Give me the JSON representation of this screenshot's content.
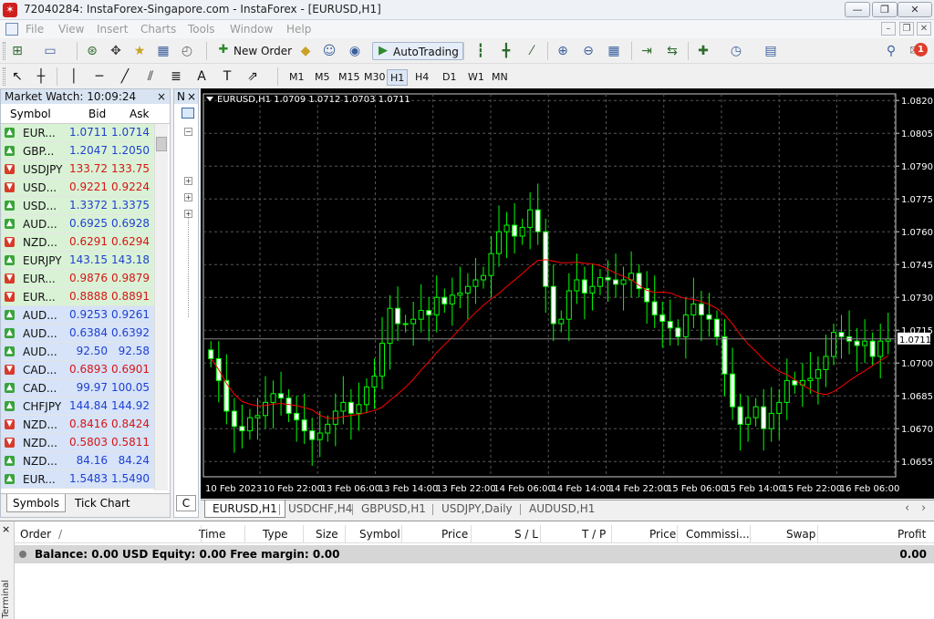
{
  "window": {
    "title": "72040284: InstaForex-Singapore.com - InstaForex - [EURUSD,H1]",
    "minimize": "—",
    "maximize": "❐",
    "close": "✕"
  },
  "menu": {
    "items": [
      "File",
      "View",
      "Insert",
      "Charts",
      "Tools",
      "Window",
      "Help"
    ],
    "mdi_minimize": "–",
    "mdi_restore": "❐",
    "mdi_close": "✕"
  },
  "toolbar": {
    "new_order_label": "New Order",
    "autotrading_label": "AutoTrading",
    "notification_count": "1"
  },
  "timeframes": {
    "items": [
      "M1",
      "M5",
      "M15",
      "M30",
      "H1",
      "H4",
      "D1",
      "W1",
      "MN"
    ],
    "active": "H1"
  },
  "market_watch": {
    "title": "Market Watch: 10:09:24",
    "close": "×",
    "columns": {
      "symbol": "Symbol",
      "bid": "Bid",
      "ask": "Ask"
    },
    "rows": [
      {
        "symbol": "EUR...",
        "bid": "1.0711",
        "ask": "1.0714",
        "dir": "up",
        "hl": "green"
      },
      {
        "symbol": "GBP...",
        "bid": "1.2047",
        "ask": "1.2050",
        "dir": "up",
        "hl": "green"
      },
      {
        "symbol": "USDJPY",
        "bid": "133.72",
        "ask": "133.75",
        "dir": "down",
        "hl": "green"
      },
      {
        "symbol": "USD...",
        "bid": "0.9221",
        "ask": "0.9224",
        "dir": "down",
        "hl": "green"
      },
      {
        "symbol": "USD...",
        "bid": "1.3372",
        "ask": "1.3375",
        "dir": "up",
        "hl": "green"
      },
      {
        "symbol": "AUD...",
        "bid": "0.6925",
        "ask": "0.6928",
        "dir": "up",
        "hl": "green"
      },
      {
        "symbol": "NZD...",
        "bid": "0.6291",
        "ask": "0.6294",
        "dir": "down",
        "hl": "green"
      },
      {
        "symbol": "EURJPY",
        "bid": "143.15",
        "ask": "143.18",
        "dir": "up",
        "hl": "green"
      },
      {
        "symbol": "EUR...",
        "bid": "0.9876",
        "ask": "0.9879",
        "dir": "down",
        "hl": "green"
      },
      {
        "symbol": "EUR...",
        "bid": "0.8888",
        "ask": "0.8891",
        "dir": "down",
        "hl": "green"
      },
      {
        "symbol": "AUD...",
        "bid": "0.9253",
        "ask": "0.9261",
        "dir": "up",
        "hl": "blue"
      },
      {
        "symbol": "AUD...",
        "bid": "0.6384",
        "ask": "0.6392",
        "dir": "up",
        "hl": "blue"
      },
      {
        "symbol": "AUD...",
        "bid": "92.50",
        "ask": "92.58",
        "dir": "up",
        "hl": "blue"
      },
      {
        "symbol": "CAD...",
        "bid": "0.6893",
        "ask": "0.6901",
        "dir": "down",
        "hl": "blue"
      },
      {
        "symbol": "CAD...",
        "bid": "99.97",
        "ask": "100.05",
        "dir": "up",
        "hl": "blue"
      },
      {
        "symbol": "CHFJPY",
        "bid": "144.84",
        "ask": "144.92",
        "dir": "up",
        "hl": "blue"
      },
      {
        "symbol": "NZD...",
        "bid": "0.8416",
        "ask": "0.8424",
        "dir": "down",
        "hl": "blue"
      },
      {
        "symbol": "NZD...",
        "bid": "0.5803",
        "ask": "0.5811",
        "dir": "down",
        "hl": "blue"
      },
      {
        "symbol": "NZD...",
        "bid": "84.16",
        "ask": "84.24",
        "dir": "up",
        "hl": "blue"
      },
      {
        "symbol": "EUR...",
        "bid": "1.5483",
        "ask": "1.5490",
        "dir": "up",
        "hl": "blue"
      }
    ],
    "tabs": [
      "Symbols",
      "Tick Chart"
    ]
  },
  "navigator": {
    "title": "N",
    "close": "×",
    "bottom_label": "C"
  },
  "chart": {
    "header": "EURUSD,H1  1.0709 1.0712 1.0703 1.0711",
    "current_price": "1.0711",
    "price_labels": [
      "1.0820",
      "1.0805",
      "1.0790",
      "1.0775",
      "1.0760",
      "1.0745",
      "1.0730",
      "1.0715",
      "1.0700",
      "1.0685",
      "1.0670",
      "1.0655"
    ],
    "time_labels": [
      "10 Feb 2023",
      "10 Feb 22:00",
      "13 Feb 06:00",
      "13 Feb 14:00",
      "13 Feb 22:00",
      "14 Feb 06:00",
      "14 Feb 14:00",
      "14 Feb 22:00",
      "15 Feb 06:00",
      "15 Feb 14:00",
      "15 Feb 22:00",
      "16 Feb 06:00"
    ],
    "colors": {
      "bg": "#000000",
      "bull": "#00ff00",
      "bear": "#00ff00",
      "body_bull": "#000000",
      "body_bear": "#ffffff",
      "ma": "#ff0000",
      "grid": "#555555",
      "axis_text": "#ffffff"
    }
  },
  "chart_data": {
    "type": "candlestick",
    "ylim": [
      1.0648,
      1.0823
    ],
    "grid": true,
    "close": [
      1.0702,
      1.0692,
      1.0678,
      1.0671,
      1.0669,
      1.0675,
      1.0676,
      1.0682,
      1.0686,
      1.0684,
      1.0677,
      1.0674,
      1.0669,
      1.0665,
      1.0668,
      1.0672,
      1.0678,
      1.0682,
      1.0677,
      1.0681,
      1.0689,
      1.0694,
      1.0709,
      1.0725,
      1.0718,
      1.0718,
      1.072,
      1.0724,
      1.0722,
      1.073,
      1.0727,
      1.0731,
      1.0732,
      1.0735,
      1.0738,
      1.074,
      1.075,
      1.076,
      1.0763,
      1.0758,
      1.0762,
      1.077,
      1.076,
      1.0735,
      1.0718,
      1.072,
      1.0733,
      1.0738,
      1.0732,
      1.0735,
      1.0739,
      1.0738,
      1.0736,
      1.0738,
      1.0741,
      1.0734,
      1.0728,
      1.0722,
      1.0719,
      1.0716,
      1.0712,
      1.0722,
      1.0727,
      1.0722,
      1.072,
      1.0712,
      1.0695,
      1.068,
      1.0672,
      1.0675,
      1.068,
      1.067,
      1.0677,
      1.0682,
      1.0692,
      1.069,
      1.0692,
      1.0693,
      1.0697,
      1.0703,
      1.0714,
      1.0712,
      1.071,
      1.0708,
      1.071,
      1.0703,
      1.071,
      1.0711
    ]
  },
  "chart_tabs": [
    "EURUSD,H1",
    "USDCHF,H4",
    "GBPUSD,H1",
    "USDJPY,Daily",
    "AUDUSD,H1"
  ],
  "terminal": {
    "side_label": "Terminal",
    "close": "×",
    "columns": [
      "Order",
      "/",
      "Time",
      "Type",
      "Size",
      "Symbol",
      "Price",
      "S / L",
      "T / P",
      "Price",
      "Commissi...",
      "Swap",
      "Profit"
    ],
    "balance_text": "Balance: 0.00 USD  Equity: 0.00  Free margin: 0.00",
    "profit": "0.00"
  }
}
